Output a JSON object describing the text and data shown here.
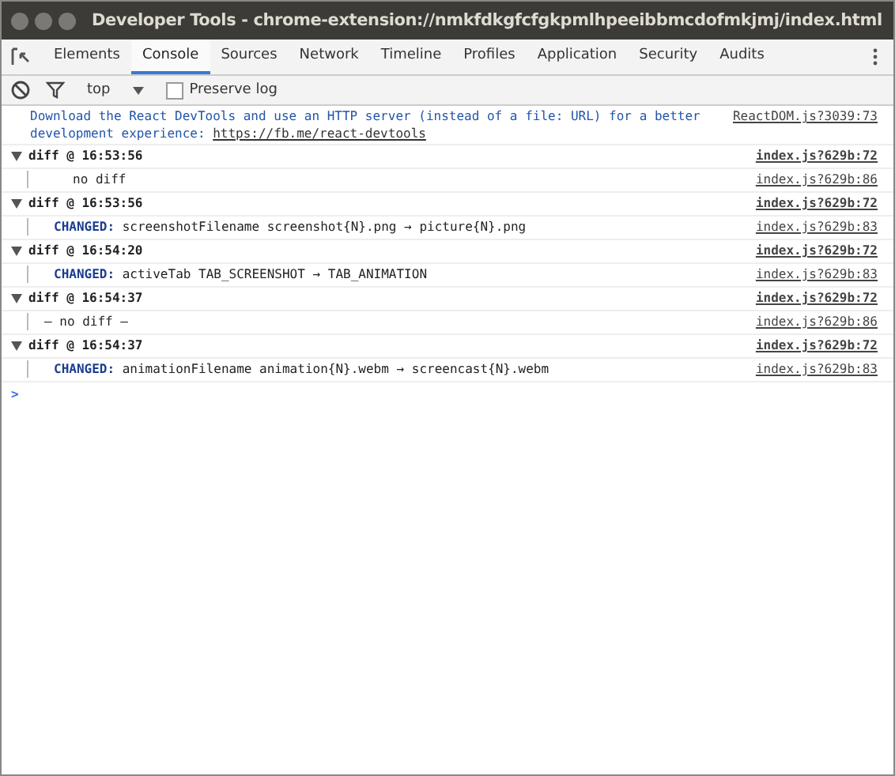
{
  "window": {
    "title": "Developer Tools - chrome-extension://nmkfdkgfcfgkpmlhpeeibbmcdofmkjmj/index.html"
  },
  "tabs": [
    {
      "label": "Elements",
      "selected": false
    },
    {
      "label": "Console",
      "selected": true
    },
    {
      "label": "Sources",
      "selected": false
    },
    {
      "label": "Network",
      "selected": false
    },
    {
      "label": "Timeline",
      "selected": false
    },
    {
      "label": "Profiles",
      "selected": false
    },
    {
      "label": "Application",
      "selected": false
    },
    {
      "label": "Security",
      "selected": false
    },
    {
      "label": "Audits",
      "selected": false
    }
  ],
  "filter_bar": {
    "context": "top",
    "preserve_log": {
      "label": "Preserve log",
      "checked": false
    }
  },
  "messages": [
    {
      "kind": "info",
      "text": "Download the React DevTools and use an HTTP server (instead of a file: URL) for a better development experience: ",
      "link": "https://fb.me/react-devtools",
      "source": "ReactDOM.js?3039:73"
    },
    {
      "kind": "group",
      "expanded": true,
      "title": "diff @ 16:53:56",
      "source": "index.js?629b:72",
      "children": [
        {
          "kind": "plain",
          "text": "no diff",
          "source": "index.js?629b:86"
        }
      ]
    },
    {
      "kind": "group",
      "expanded": true,
      "title": "diff @ 16:53:56",
      "source": "index.js?629b:72",
      "children": [
        {
          "kind": "changed",
          "label": "CHANGED:",
          "text": "screenshotFilename screenshot{N}.png → picture{N}.png",
          "source": "index.js?629b:83"
        }
      ]
    },
    {
      "kind": "group",
      "expanded": true,
      "title": "diff @ 16:54:20",
      "source": "index.js?629b:72",
      "children": [
        {
          "kind": "changed",
          "label": "CHANGED:",
          "text": "activeTab TAB_SCREENSHOT → TAB_ANIMATION",
          "source": "index.js?629b:83"
        }
      ]
    },
    {
      "kind": "group",
      "expanded": true,
      "title": "diff @ 16:54:37",
      "source": "index.js?629b:72",
      "children": [
        {
          "kind": "plain",
          "text": "— no diff —",
          "source": "index.js?629b:86"
        }
      ]
    },
    {
      "kind": "group",
      "expanded": true,
      "title": "diff @ 16:54:37",
      "source": "index.js?629b:72",
      "children": [
        {
          "kind": "changed",
          "label": "CHANGED:",
          "text": "animationFilename animation{N}.webm → screencast{N}.webm",
          "source": "index.js?629b:83"
        }
      ]
    }
  ],
  "prompt": ">"
}
